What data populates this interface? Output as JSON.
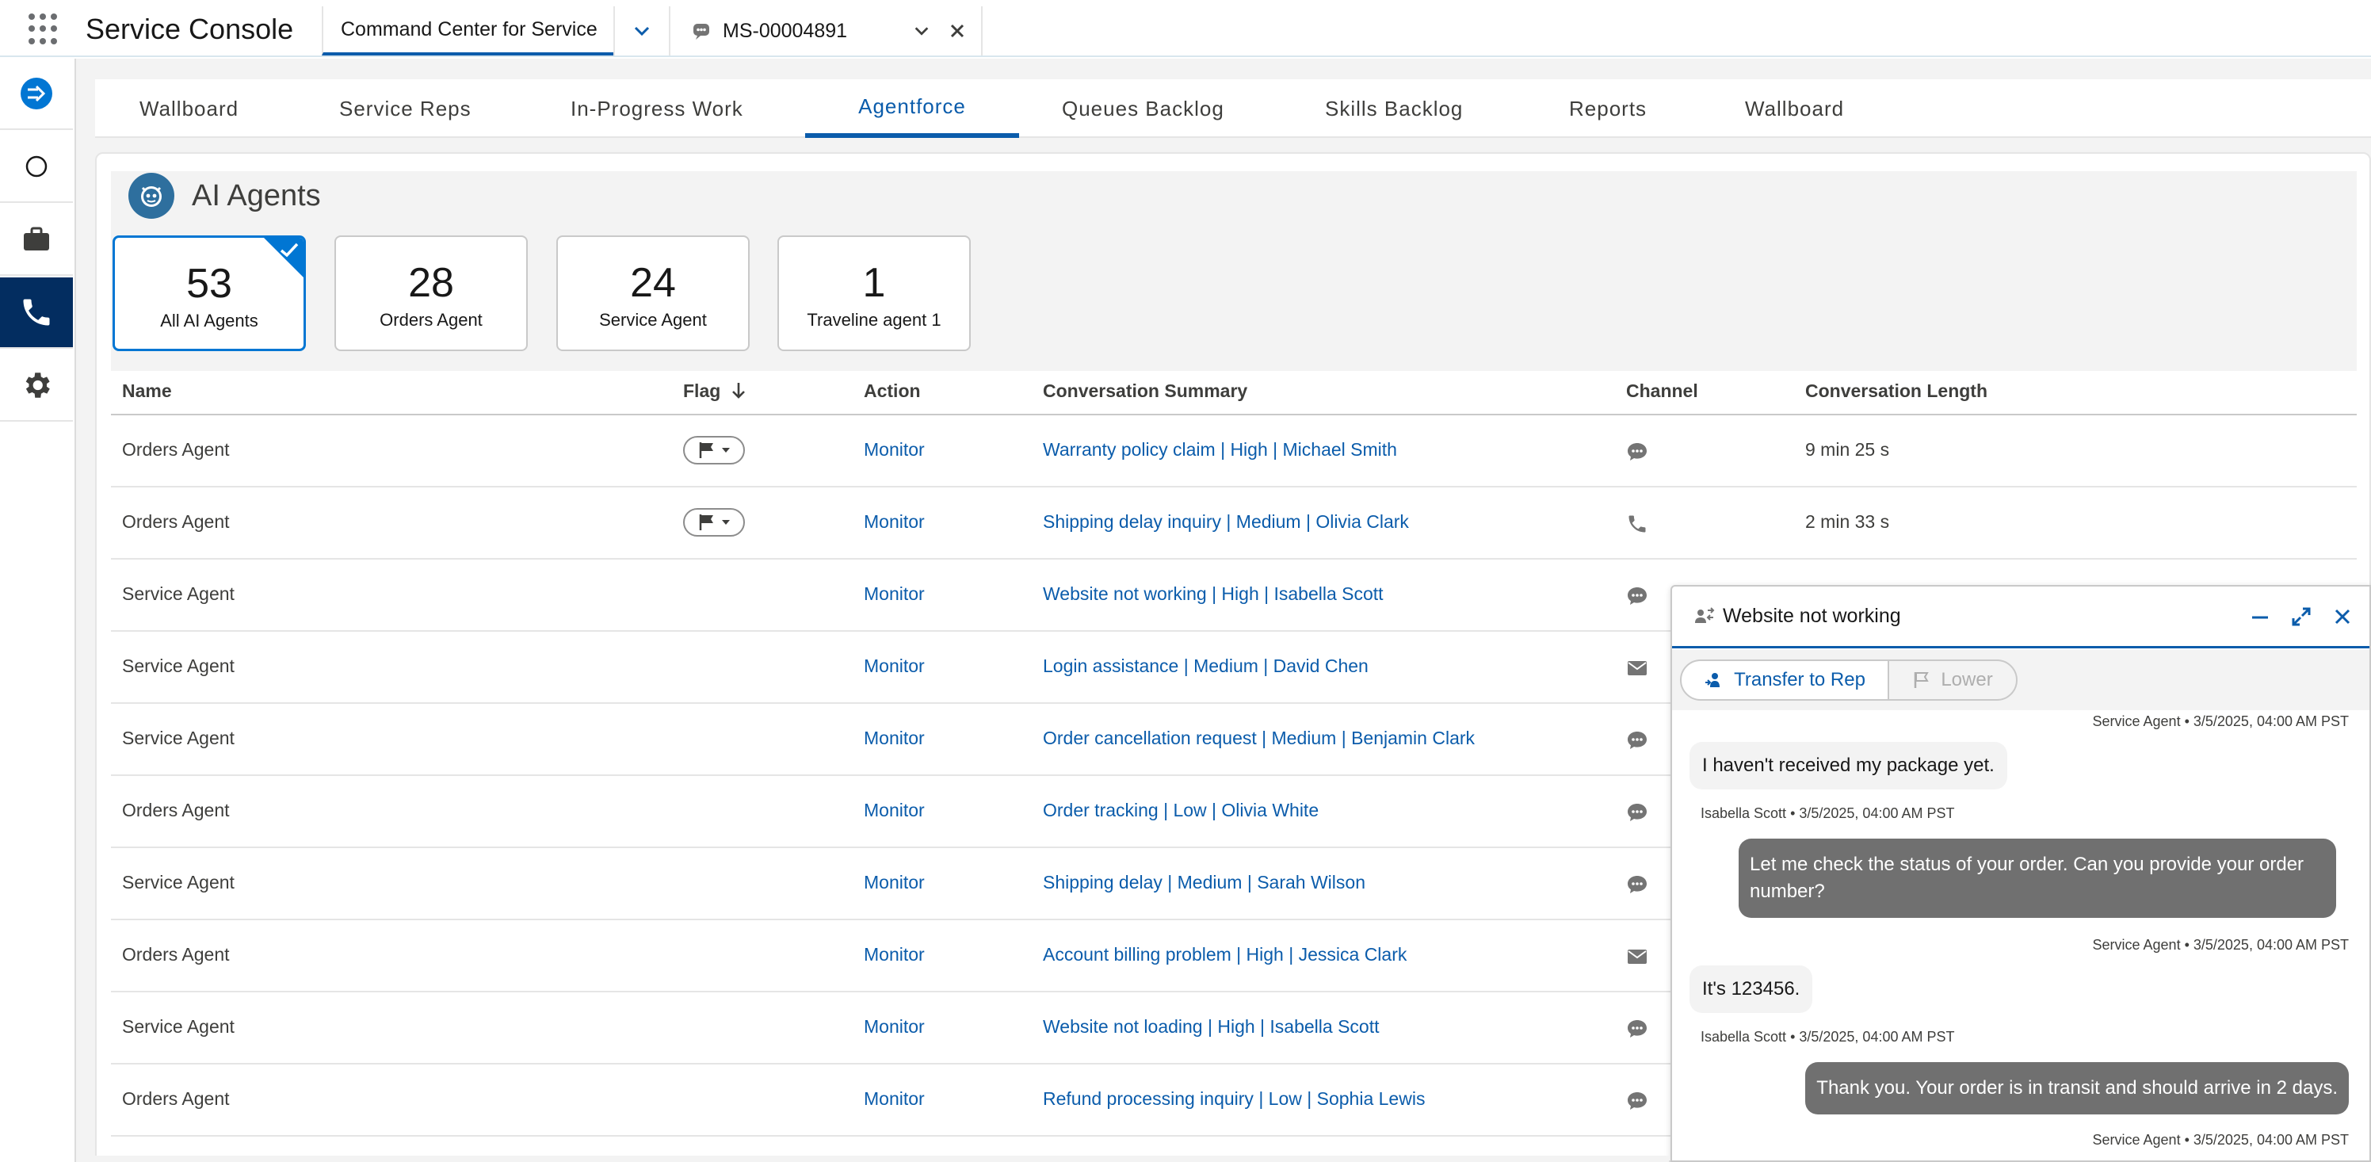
{
  "app": {
    "name": "Service Console",
    "tabs": [
      {
        "label": "Command Center for Service",
        "active": true
      },
      {
        "label": "MS-00004891",
        "active": false
      }
    ]
  },
  "subtabs": [
    "Wallboard",
    "Service Reps",
    "In-Progress Work",
    "Agentforce",
    "Queues Backlog",
    "Skills Backlog",
    "Reports",
    "Wallboard"
  ],
  "active_subtab": "Agentforce",
  "section_title": "AI Agents",
  "stats": [
    {
      "value": "53",
      "label": "All AI Agents",
      "selected": true
    },
    {
      "value": "28",
      "label": "Orders Agent",
      "selected": false
    },
    {
      "value": "24",
      "label": "Service Agent",
      "selected": false
    },
    {
      "value": "1",
      "label": "Traveline agent 1",
      "selected": false
    }
  ],
  "table": {
    "columns": [
      "Name",
      "Flag",
      "Action",
      "Conversation Summary",
      "Channel",
      "Conversation Length"
    ],
    "sort_icon": "arrow-down-icon",
    "rows": [
      {
        "name": "Orders Agent",
        "flag": true,
        "action": "Monitor",
        "summary": "Warranty policy claim | High | Michael Smith",
        "channel": "chat",
        "length": "9 min 25 s"
      },
      {
        "name": "Orders Agent",
        "flag": true,
        "action": "Monitor",
        "summary": "Shipping delay inquiry | Medium | Olivia Clark",
        "channel": "phone",
        "length": "2 min 33 s"
      },
      {
        "name": "Service Agent",
        "flag": false,
        "action": "Monitor",
        "summary": "Website not working | High | Isabella Scott",
        "channel": "chat",
        "length": ""
      },
      {
        "name": "Service Agent",
        "flag": false,
        "action": "Monitor",
        "summary": "Login assistance | Medium | David Chen",
        "channel": "email",
        "length": ""
      },
      {
        "name": "Service Agent",
        "flag": false,
        "action": "Monitor",
        "summary": "Order cancellation request | Medium | Benjamin Clark",
        "channel": "chat",
        "length": ""
      },
      {
        "name": "Orders Agent",
        "flag": false,
        "action": "Monitor",
        "summary": "Order tracking | Low | Olivia White",
        "channel": "chat",
        "length": ""
      },
      {
        "name": "Service Agent",
        "flag": false,
        "action": "Monitor",
        "summary": "Shipping delay | Medium | Sarah Wilson",
        "channel": "chat",
        "length": ""
      },
      {
        "name": "Orders Agent",
        "flag": false,
        "action": "Monitor",
        "summary": "Account billing problem | High | Jessica Clark",
        "channel": "email",
        "length": ""
      },
      {
        "name": "Service Agent",
        "flag": false,
        "action": "Monitor",
        "summary": "Website not loading | High | Isabella Scott",
        "channel": "chat",
        "length": ""
      },
      {
        "name": "Orders Agent",
        "flag": false,
        "action": "Monitor",
        "summary": "Refund processing inquiry | Low | Sophia Lewis",
        "channel": "chat",
        "length": ""
      }
    ]
  },
  "chat": {
    "title": "Website not working",
    "transfer_label": "Transfer to Rep",
    "lower_label": "Lower",
    "messages": [
      {
        "meta_top": "Service Agent • 3/5/2025, 04:00 AM PST"
      },
      {
        "from": "customer",
        "text": "I haven't received my package yet.",
        "meta": "Isabella Scott • 3/5/2025, 04:00 AM PST"
      },
      {
        "from": "agent",
        "text": "Let me check the status of your order. Can you provide your order number?",
        "meta": "Service Agent • 3/5/2025, 04:00 AM PST"
      },
      {
        "from": "customer",
        "text": "It's 123456.",
        "meta": "Isabella Scott • 3/5/2025, 04:00 AM PST"
      },
      {
        "from": "agent",
        "text": "Thank you. Your order is in transit and should arrive in 2 days.",
        "meta": "Service Agent • 3/5/2025, 04:00 AM PST"
      }
    ]
  },
  "colors": {
    "brand": "#0b5cab",
    "accent": "#0176d3",
    "rail_active": "#032d60",
    "agent_bubble": "#707070"
  }
}
